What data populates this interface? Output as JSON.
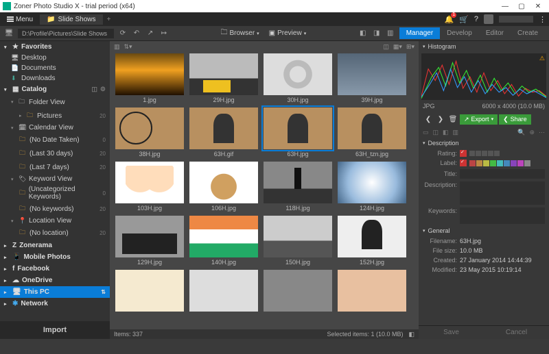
{
  "titlebar": {
    "title": "Zoner Photo Studio X - trial period (x64)"
  },
  "menubar": {
    "menu": "Menu",
    "tab": "Slide Shows"
  },
  "toolbar": {
    "path": "D:\\Profile\\Pictures\\Slide Shows",
    "browser": "Browser",
    "preview": "Preview",
    "modes": {
      "manager": "Manager",
      "develop": "Develop",
      "editor": "Editor",
      "create": "Create"
    }
  },
  "sidebar": {
    "favorites": "Favorites",
    "fav_items": [
      "Desktop",
      "Documents",
      "Downloads"
    ],
    "catalog": "Catalog",
    "folder_view": "Folder View",
    "pictures": "Pictures",
    "pictures_count": "20",
    "calendar_view": "Calendar View",
    "cal_items": [
      {
        "label": "(No Date Taken)",
        "count": "0"
      },
      {
        "label": "(Last 30 days)",
        "count": "20"
      },
      {
        "label": "(Last 7 days)",
        "count": "20"
      }
    ],
    "keyword_view": "Keyword View",
    "kw_items": [
      {
        "label": "(Uncategorized Keywords)",
        "count": "0"
      },
      {
        "label": "(No keywords)",
        "count": "20"
      }
    ],
    "location_view": "Location View",
    "loc_item": {
      "label": "(No location)",
      "count": "20"
    },
    "zonerama": "Zonerama",
    "mobile": "Mobile Photos",
    "facebook": "Facebook",
    "onedrive": "OneDrive",
    "thispc": "This PC",
    "network": "Network",
    "import": "Import"
  },
  "thumbs": [
    {
      "name": "1.jpg",
      "cls": "t1"
    },
    {
      "name": "29H.jpg",
      "cls": "t2"
    },
    {
      "name": "30H.jpg",
      "cls": "t3"
    },
    {
      "name": "39H.jpg",
      "cls": "t4"
    },
    {
      "name": "38H.jpg",
      "cls": "t5"
    },
    {
      "name": "63H.gif",
      "cls": "t6"
    },
    {
      "name": "63H.jpg",
      "cls": "t7",
      "sel": true
    },
    {
      "name": "63H_tzn.jpg",
      "cls": "t8"
    },
    {
      "name": "103H.jpg",
      "cls": "t9"
    },
    {
      "name": "106H.jpg",
      "cls": "t10"
    },
    {
      "name": "118H.jpg",
      "cls": "t11"
    },
    {
      "name": "124H.jpg",
      "cls": "t12"
    },
    {
      "name": "129H.jpg",
      "cls": "t13"
    },
    {
      "name": "140H.jpg",
      "cls": "t14"
    },
    {
      "name": "150H.jpg",
      "cls": "t15"
    },
    {
      "name": "152H.jpg",
      "cls": "t16"
    },
    {
      "name": "",
      "cls": "t17"
    },
    {
      "name": "",
      "cls": "t18"
    },
    {
      "name": "",
      "cls": "t19"
    },
    {
      "name": "",
      "cls": "t20"
    }
  ],
  "status": {
    "items": "Items: 337",
    "selected": "Selected items: 1 (10.0 MB)"
  },
  "rpanel": {
    "histogram": "Histogram",
    "format": "JPG",
    "dims": "6000 x 4000 (10.0 MB)",
    "export": "Export",
    "share": "Share",
    "description": "Description",
    "rating": "Rating:",
    "label": "Label:",
    "title": "Title:",
    "desc": "Description:",
    "keywords": "Keywords:",
    "general": "General",
    "filename_l": "Filename:",
    "filename": "63H.jpg",
    "filesize_l": "File size:",
    "filesize": "10.0 MB",
    "created_l": "Created:",
    "created": "27 January 2014 14:44:39",
    "modified_l": "Modified:",
    "modified": "23 May 2015 10:19:14",
    "save": "Save",
    "cancel": "Cancel"
  },
  "swatches": [
    "#b44",
    "#b84",
    "#bb4",
    "#4b4",
    "#4bb",
    "#48b",
    "#84b",
    "#b4b",
    "#888"
  ]
}
